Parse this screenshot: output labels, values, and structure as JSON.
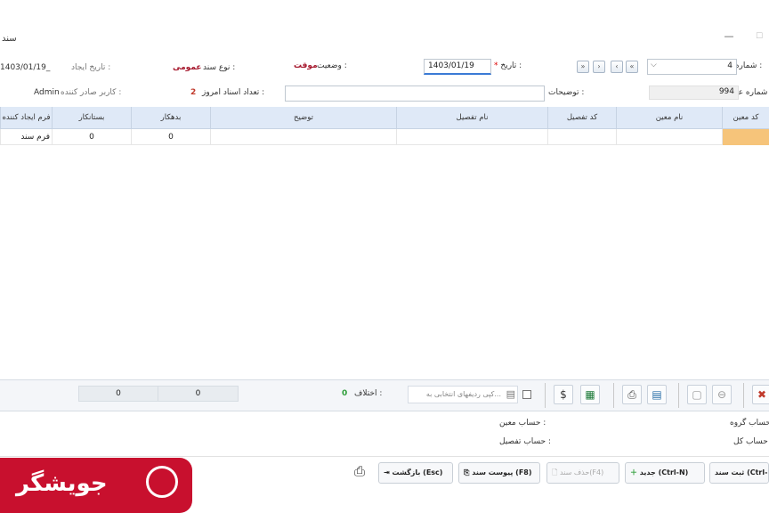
{
  "window": {
    "title": "سند",
    "minimize": "—",
    "maximize": "☐"
  },
  "header": {
    "voucher_number_label": "شماره سند :",
    "voucher_number": "4",
    "date_label": "تاریخ :",
    "date_required_mark": "*",
    "date_value": "1403/01/19",
    "status_label": "وضعیت :",
    "status_value": "موقت",
    "type_label": "نوع سند :",
    "type_value": "عمومی",
    "created_label": "تاریخ ایجاد :",
    "created_value": "1403/01/19_",
    "ref_label": "شماره عطف :",
    "ref_value": "994",
    "desc_label": "توضیحات :",
    "today_count_label": "تعداد اسناد امروز :",
    "today_count_value": "2",
    "issuer_label": "کاربر صادر کننده :",
    "issuer_value": "Admin"
  },
  "nav": {
    "first": "«",
    "prev": "‹",
    "next": "›",
    "last": "»"
  },
  "grid": {
    "columns": [
      "کد معین",
      "نام معین",
      "کد تفصیل",
      "نام تفصیل",
      "توضیح",
      "بدهکار",
      "بستانکار",
      "فرم ایجاد کننده"
    ],
    "rows": [
      {
        "debit": "0",
        "credit": "0",
        "form": "فرم سند"
      }
    ]
  },
  "toolbar": {
    "debit_total": "0",
    "credit_total": "0",
    "difference_label": "اختلاف :",
    "difference_value": "0",
    "copy_rows_placeholder": "کپی ردیفهای انتخابی به..."
  },
  "info": {
    "group_account_label": "حساب گروه :",
    "general_account_label": "حساب کل :",
    "moein_account_label": "حساب معین :",
    "detail_account_label": "حساب تفصیل :"
  },
  "buttons": {
    "save": "ثبت سند (Ctrl-S)",
    "new": "جدید (Ctrl-N)",
    "delete": "حذف سند(F4)",
    "attach": "پیوست سند (F8)",
    "back": "بازگشت (Esc)"
  },
  "logo": {
    "text": "جویشگر"
  },
  "colors": {
    "accent": "#c8102e",
    "grid_header": "#dfe9f7",
    "selected_cell": "#f6c47a"
  }
}
